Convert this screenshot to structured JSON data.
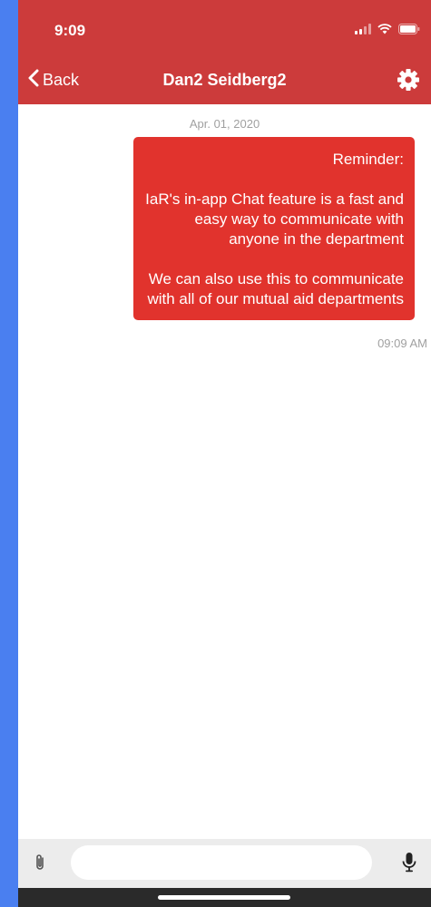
{
  "status_bar": {
    "time": "9:09"
  },
  "nav": {
    "back_label": "Back",
    "title": "Dan2 Seidberg2",
    "settings_icon": "gear-icon",
    "back_icon": "chevron-left-icon"
  },
  "conversation": {
    "date": "Apr. 01, 2020",
    "message": {
      "paragraphs": [
        "Reminder:",
        "IaR's in-app Chat feature is a fast and easy way to communicate with anyone in the department",
        "We can also use this to communicate with all of our mutual aid departments"
      ],
      "time": "09:09 AM"
    }
  },
  "composer": {
    "placeholder": "",
    "value": "",
    "attach_icon": "paperclip-icon",
    "mic_icon": "microphone-icon"
  },
  "colors": {
    "header": "#cc3b3b",
    "bubble": "#e1332d",
    "background": "#4a7ff0"
  }
}
